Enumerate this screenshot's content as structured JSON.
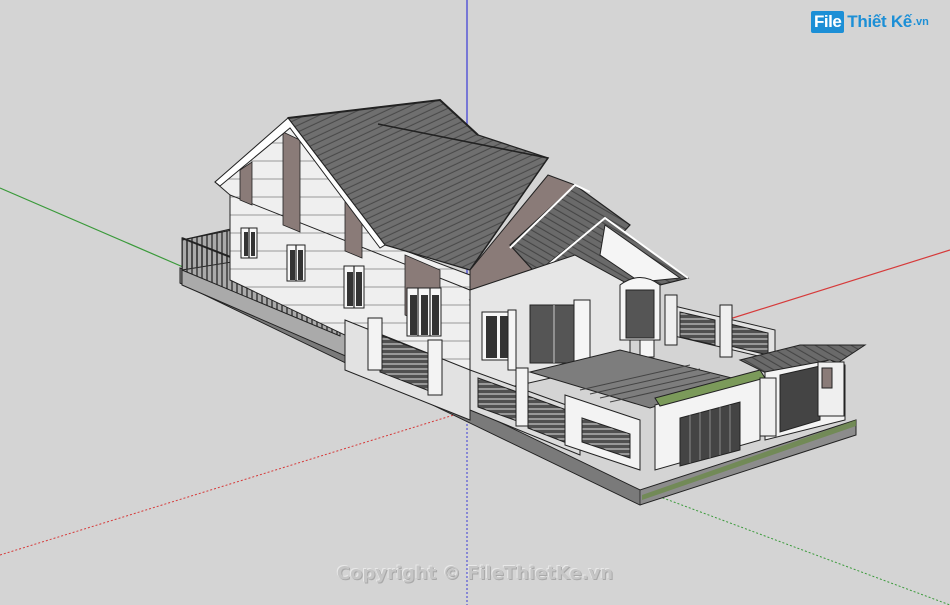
{
  "watermark": {
    "logo_box": "File",
    "logo_text": "Thiết Kế",
    "logo_domain": ".vn",
    "copyright": "Copyright © FileThietKe.vn"
  },
  "scene": {
    "background": "#d4d4d4",
    "axis_colors": {
      "red": "#d63a3a",
      "green": "#3a9a3a",
      "blue": "#3a3ad6"
    },
    "model": "3d-house-model"
  }
}
